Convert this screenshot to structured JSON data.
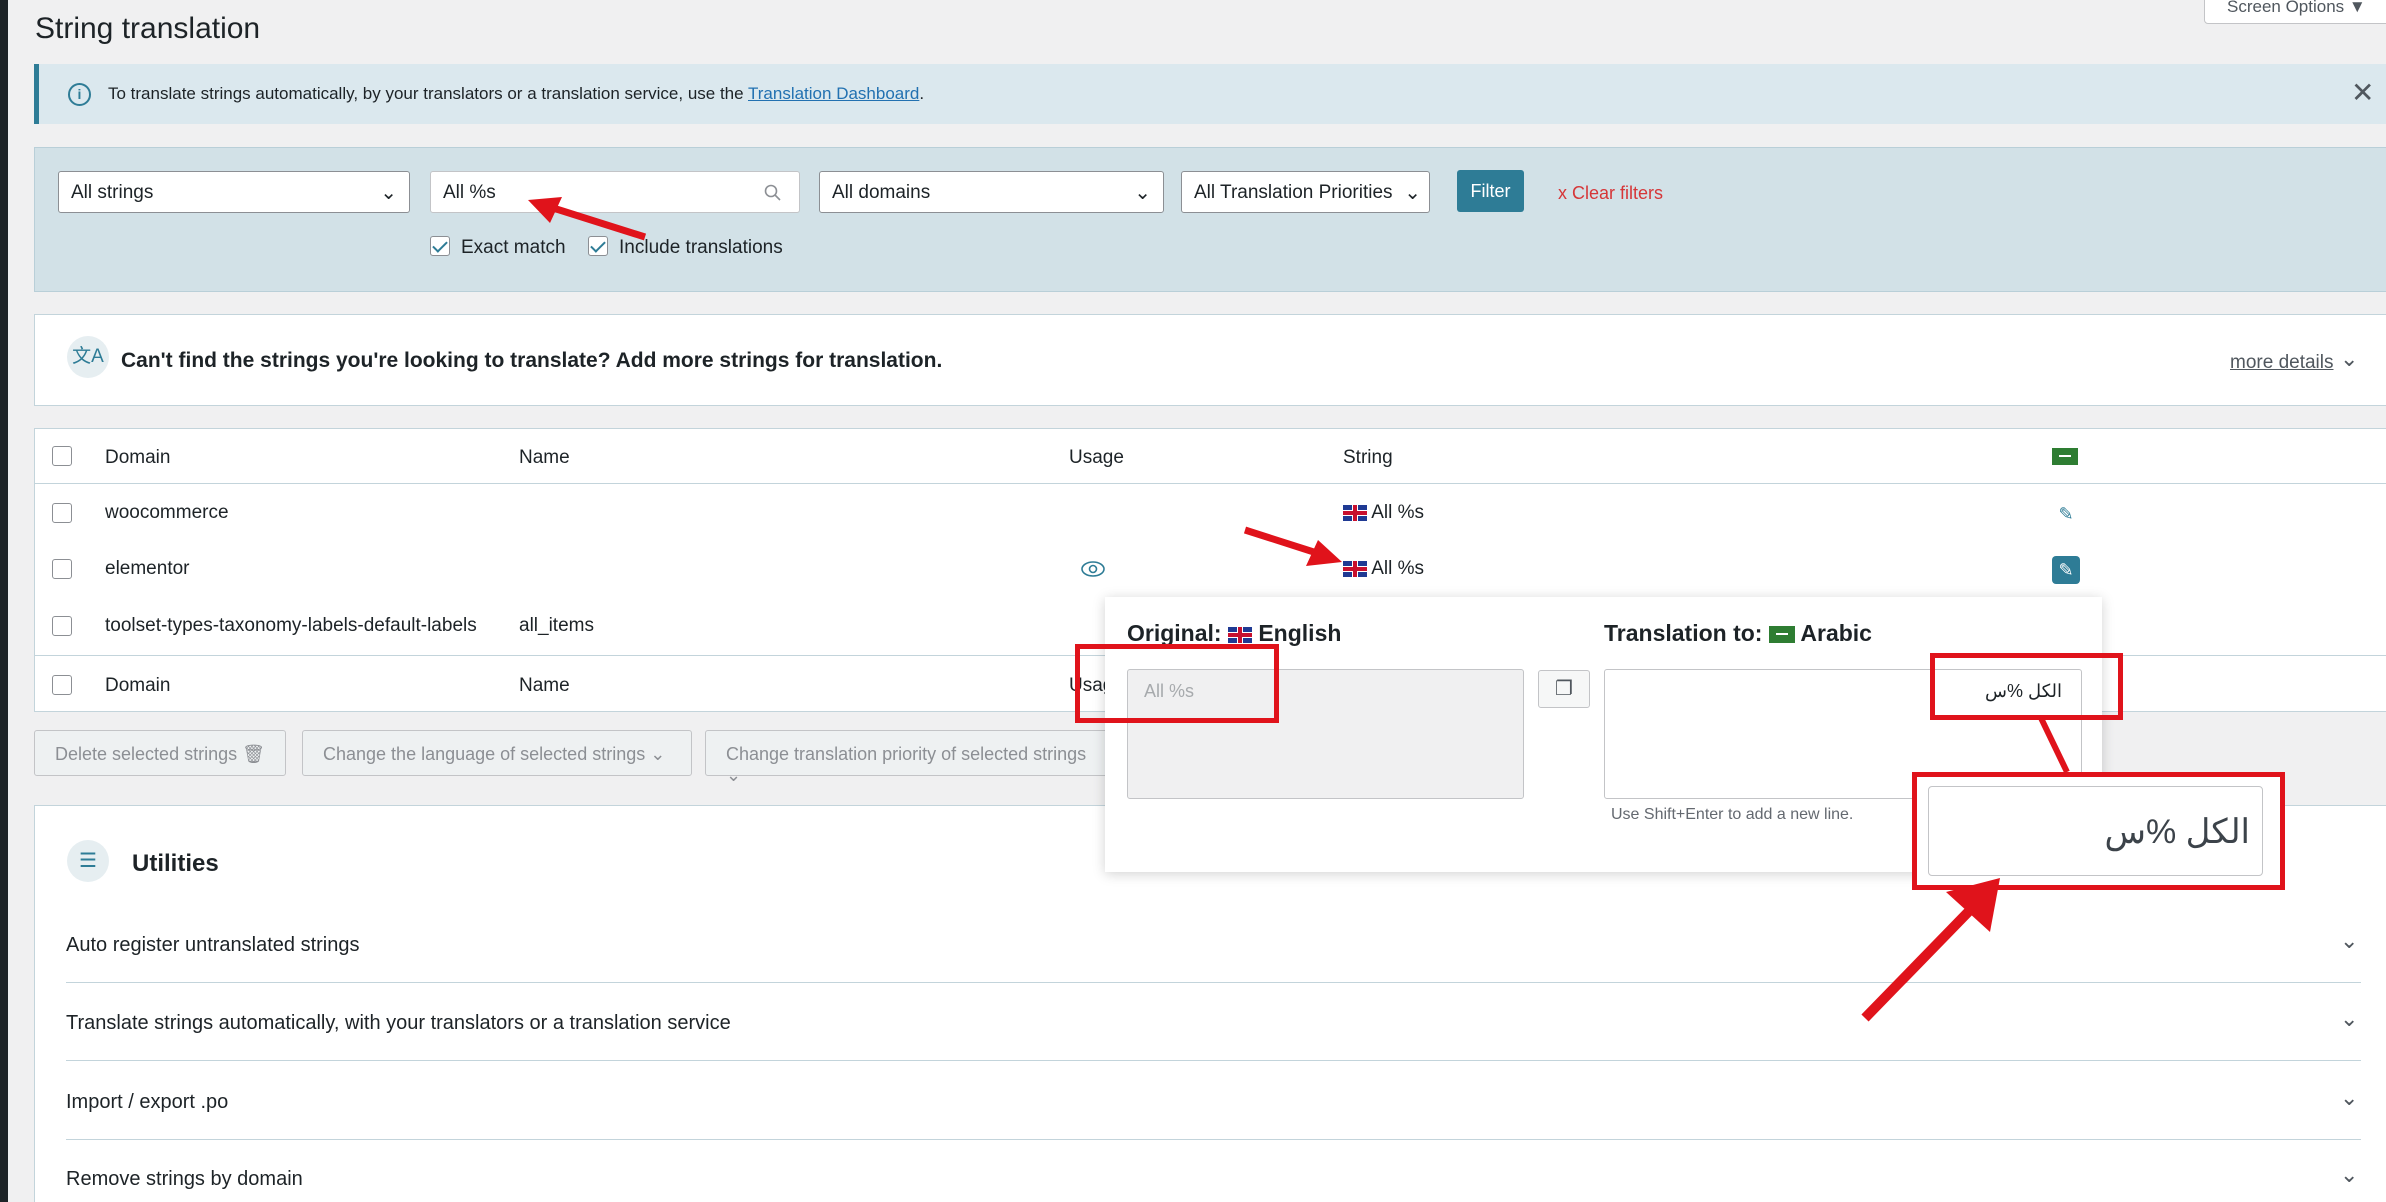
{
  "page": {
    "title": "String translation",
    "screen_options": "Screen Options ▼"
  },
  "notice": {
    "text": "To translate strings automatically, by your translators or a translation service, use the ",
    "link": "Translation Dashboard",
    "suffix": "."
  },
  "filters": {
    "strings": "All strings",
    "search_value": "All %s",
    "domains": "All domains",
    "priorities": "All Translation Priorities",
    "filter_button": "Filter",
    "clear": "x  Clear filters",
    "exact_match": "Exact match",
    "include_translations": "Include translations"
  },
  "add_strings": {
    "text": "Can't find the strings you're looking to translate? Add more strings for translation.",
    "more": "more details"
  },
  "table": {
    "headers": {
      "domain": "Domain",
      "name": "Name",
      "usage": "Usage",
      "string": "String"
    },
    "footer_usage": "Usag",
    "rows": [
      {
        "domain": "woocommerce",
        "name": "",
        "string": "All %s"
      },
      {
        "domain": "elementor",
        "name": "",
        "string": "All %s"
      },
      {
        "domain": "toolset-types-taxonomy-labels-default-labels",
        "name": "all_items",
        "string": ""
      }
    ]
  },
  "bulk": {
    "delete": "Delete selected strings",
    "change_language": "Change the language of selected strings",
    "change_priority": "Change translation priority of selected strings"
  },
  "popup": {
    "original_label": "Original:",
    "original_lang": "English",
    "original_value": "All %s",
    "translation_label": "Translation to:",
    "translation_lang": "Arabic",
    "translation_value": "الكل %س",
    "hint": "Use Shift+Enter to add a new line."
  },
  "zoom_text": "الكل %س",
  "utilities": {
    "title": "Utilities",
    "items": [
      "Auto register untranslated strings",
      "Translate strings automatically, with your translators or a translation service",
      "Import / export .po",
      "Remove strings by domain"
    ]
  },
  "colors": {
    "accent": "#2e7c96",
    "annotation_red": "#e0131b",
    "panel_bg": "#d2e1e7"
  }
}
